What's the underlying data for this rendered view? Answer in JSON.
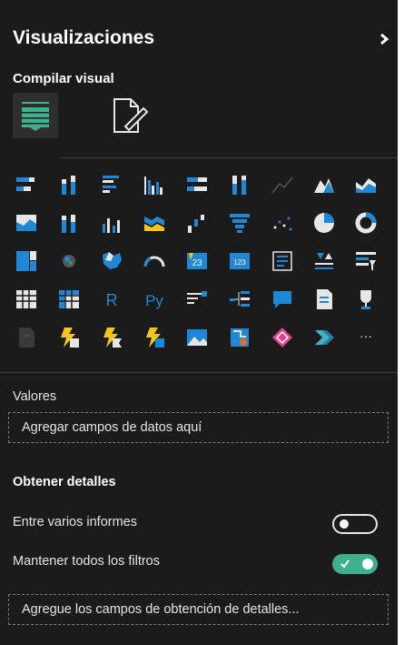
{
  "panel": {
    "title": "Visualizaciones",
    "collapse_icon": "chevron-right-icon"
  },
  "build_visual": {
    "heading": "Compilar visual",
    "tabs": [
      {
        "name": "build-visual-tab-icon",
        "selected": true
      },
      {
        "name": "format-visual-tab-icon",
        "selected": false
      }
    ]
  },
  "visual_icons": [
    [
      "stacked-bar-chart-icon",
      "stacked-column-chart-icon",
      "clustered-bar-chart-icon",
      "clustered-column-chart-icon",
      "100-stacked-bar-chart-icon",
      "100-stacked-column-chart-icon",
      "line-chart-icon",
      "area-chart-icon",
      "stacked-area-chart-icon"
    ],
    [
      "100-stacked-area-chart-icon",
      "line-and-stacked-column-chart-icon",
      "line-and-clustered-column-chart-icon",
      "ribbon-chart-icon",
      "waterfall-chart-icon",
      "funnel-chart-icon",
      "scatter-chart-icon",
      "pie-chart-icon",
      "donut-chart-icon"
    ],
    [
      "treemap-icon",
      "map-icon",
      "filled-map-icon",
      "gauge-icon",
      "card-icon",
      "multi-row-card-icon",
      "kpi-icon",
      "slicer-icon",
      "table-slicer-icon"
    ],
    [
      "table-icon",
      "matrix-icon",
      "r-script-visual-icon",
      "python-visual-icon",
      "key-influencers-icon",
      "decomposition-tree-icon",
      "qa-icon",
      "smart-narrative-icon",
      "goals-icon"
    ],
    [
      "paginated-report-icon",
      "power-apps-icon",
      "power-automate-icon",
      "power-bi-visual-icon",
      "image-visual-icon",
      "arcgis-map-icon",
      "diamond-visual-icon",
      "chevron-visual-icon",
      "more-visuals-icon"
    ]
  ],
  "visual_labels": {
    "r": "R",
    "py": "Py",
    "more": "···",
    "card_value": "23",
    "multi_card_value": "123"
  },
  "values_section": {
    "label": "Valores",
    "placeholder": "Agregar campos de datos aquí"
  },
  "drillthrough": {
    "heading": "Obtener detalles",
    "cross_report": {
      "label": "Entre varios informes",
      "state": "off"
    },
    "keep_filters": {
      "label": "Mantener todos los filtros",
      "state": "on"
    },
    "placeholder": "Agregue los campos de obtención de detalles..."
  },
  "colors": {
    "background": "#1b1b1b",
    "accent_teal": "#3fb08f",
    "icon_blue": "#1e88d6",
    "icon_yellow": "#f5c518",
    "icon_pink": "#e0418f"
  }
}
